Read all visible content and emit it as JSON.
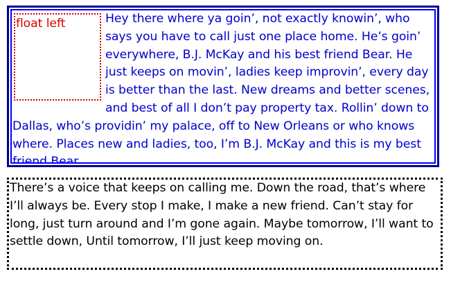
{
  "float_box": {
    "label": "float left"
  },
  "blue_box": {
    "text": "Hey there where ya goin’, not exactly knowin’, who says you have to call just one place home. He’s goin’ everywhere, B.J. McKay and his best friend Bear. He just keeps on movin’, ladies keep improvin’, every day is better than the last. New dreams and better scenes, and best of all I don’t pay property tax. Rollin’ down to Dallas, who’s providin’ my palace, off to New Orleans or who knows where. Places new and ladies, too, I’m B.J. McKay and this is my best friend Bear."
  },
  "dotted_box": {
    "text": "There’s a voice that keeps on calling me. Down the road, that’s where I’ll always be. Every stop I make, I make a new friend. Can’t stay for long, just turn around and I’m gone again. Maybe tomorrow, I’ll want to settle down, Until tomorrow, I’ll just keep moving on."
  },
  "colors": {
    "blue_border_outer": "#00008b",
    "blue_border_inner": "#0000ff",
    "blue_text": "#0000cc",
    "float_border": "#cc0000",
    "float_text": "#e00000",
    "dotted_border": "#000000"
  }
}
